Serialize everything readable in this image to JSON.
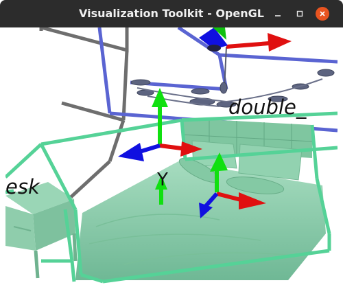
{
  "window": {
    "title": "Visualization Toolkit - OpenGL"
  },
  "controls": {
    "minimize_glyph": "–",
    "close_glyph": "×"
  },
  "scene": {
    "labels": {
      "double": "double_",
      "desk": "lesk",
      "axis_y": "Y"
    }
  },
  "colors": {
    "titlebar": "#2c2c2c",
    "close_button": "#e95420",
    "box_blue": "#5a64d2",
    "box_green": "#55d297",
    "box_gray": "#6e6e6e",
    "axis_x": "#e01010",
    "axis_y": "#10e010",
    "axis_z": "#1010e0",
    "bed": "#8ccfac"
  }
}
